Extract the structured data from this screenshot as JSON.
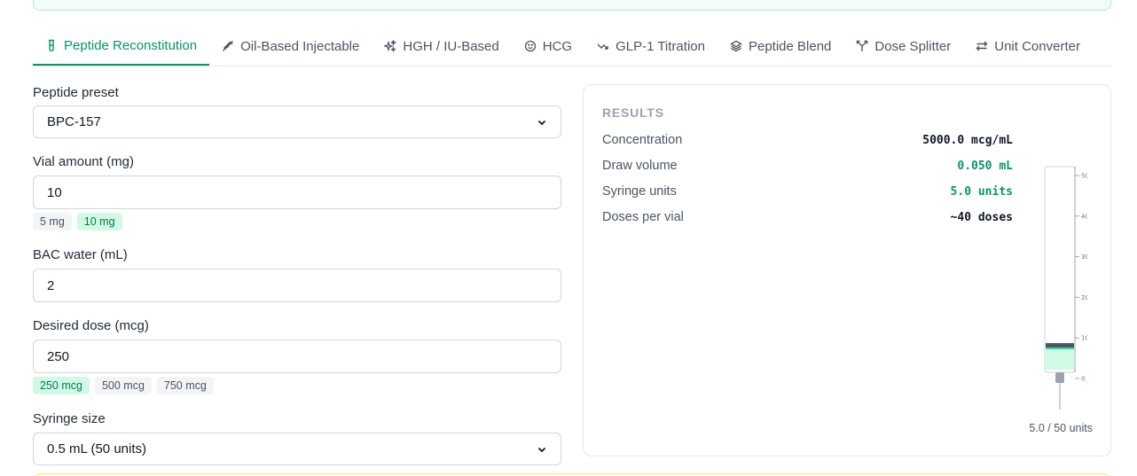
{
  "tabs": [
    {
      "label": "Peptide Reconstitution",
      "icon": "vial-icon",
      "active": true
    },
    {
      "label": "Oil-Based Injectable",
      "icon": "syringe-icon",
      "active": false
    },
    {
      "label": "HGH / IU-Based",
      "icon": "sparkle-icon",
      "active": false
    },
    {
      "label": "HCG",
      "icon": "smile-icon",
      "active": false
    },
    {
      "label": "GLP-1 Titration",
      "icon": "trend-icon",
      "active": false
    },
    {
      "label": "Peptide Blend",
      "icon": "layers-icon",
      "active": false
    },
    {
      "label": "Dose Splitter",
      "icon": "split-icon",
      "active": false
    },
    {
      "label": "Unit Converter",
      "icon": "swap-icon",
      "active": false
    }
  ],
  "form": {
    "preset_label": "Peptide preset",
    "preset_value": "BPC-157",
    "vial_label": "Vial amount (mg)",
    "vial_value": "10",
    "vial_chips": [
      {
        "label": "5 mg",
        "active": false
      },
      {
        "label": "10 mg",
        "active": true
      }
    ],
    "bac_label": "BAC water (mL)",
    "bac_value": "2",
    "dose_label": "Desired dose (mcg)",
    "dose_value": "250",
    "dose_chips": [
      {
        "label": "250 mcg",
        "active": true
      },
      {
        "label": "500 mcg",
        "active": false
      },
      {
        "label": "750 mcg",
        "active": false
      }
    ],
    "syringe_label": "Syringe size",
    "syringe_value": "0.5 mL (50 units)"
  },
  "results": {
    "title": "RESULTS",
    "rows": [
      {
        "label": "Concentration",
        "value": "5000.0 mcg/mL",
        "highlight": false
      },
      {
        "label": "Draw volume",
        "value": "0.050 mL",
        "highlight": true
      },
      {
        "label": "Syringe units",
        "value": "5.0 units",
        "highlight": true
      },
      {
        "label": "Doses per vial",
        "value": "~40 doses",
        "highlight": false
      }
    ],
    "syringe": {
      "fill_units": 5,
      "max_units": 50,
      "ticks": [
        "50",
        "40",
        "30",
        "20",
        "10",
        "0"
      ],
      "caption": "5.0 / 50 units"
    }
  },
  "colors": {
    "accent": "#059669",
    "accent_light": "#d1fae5",
    "border": "#d1d5db"
  }
}
